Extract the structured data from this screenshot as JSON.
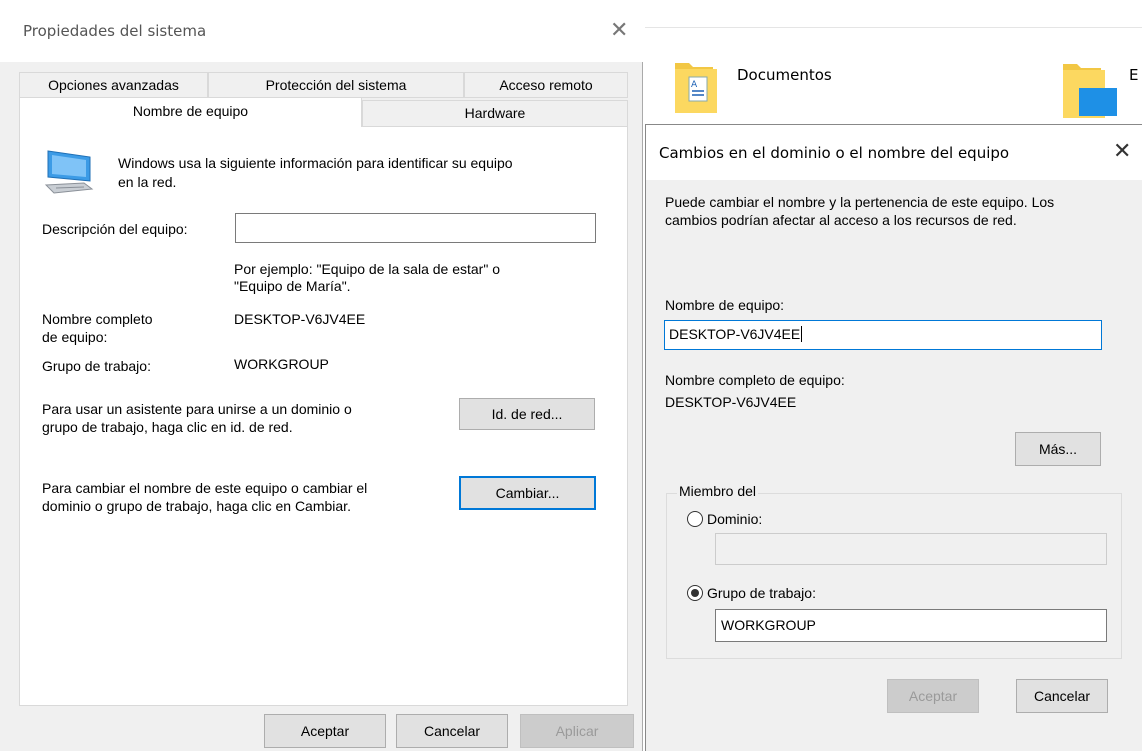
{
  "explorer": {
    "items": [
      {
        "label": "Documentos"
      },
      {
        "label": "E"
      }
    ]
  },
  "system_properties": {
    "title": "Propiedades del sistema",
    "tabs_row1": [
      "Opciones avanzadas",
      "Protección del sistema",
      "Acceso remoto"
    ],
    "tabs_row2": [
      "Nombre de equipo",
      "Hardware"
    ],
    "active_tab": "Nombre de equipo",
    "info_line1": "Windows usa la siguiente información para identificar su equipo",
    "info_line2": "en la red.",
    "description_label": "Descripción del equipo:",
    "description_value": "",
    "example_line1": "Por ejemplo: \"Equipo de la sala de estar\" o",
    "example_line2": "\"Equipo de María\".",
    "fullname_label_line1": "Nombre completo",
    "fullname_label_line2": "de equipo:",
    "fullname_value": "DESKTOP-V6JV4EE",
    "workgroup_label": "Grupo de trabajo:",
    "workgroup_value": "WORKGROUP",
    "network_id_text_line1": "Para usar un asistente para unirse a un dominio o",
    "network_id_text_line2": "grupo de trabajo, haga clic en id. de red.",
    "network_id_button": "Id. de red...",
    "change_text_line1": "Para cambiar el nombre de este equipo o cambiar el",
    "change_text_line2": "dominio o grupo de trabajo, haga clic en Cambiar.",
    "change_button": "Cambiar...",
    "ok_button": "Aceptar",
    "cancel_button": "Cancelar",
    "apply_button": "Aplicar"
  },
  "name_changes": {
    "title": "Cambios en el dominio o el nombre del equipo",
    "intro_line1": "Puede cambiar el nombre y la pertenencia de este equipo. Los",
    "intro_line2": "cambios podrían afectar al acceso a los recursos de red.",
    "computer_name_label": "Nombre de equipo:",
    "computer_name_value": "DESKTOP-V6JV4EE",
    "full_name_label": "Nombre completo de equipo:",
    "full_name_value": "DESKTOP-V6JV4EE",
    "more_button": "Más...",
    "member_of_label": "Miembro del",
    "domain_radio_label": "Dominio:",
    "domain_value": "",
    "workgroup_radio_label": "Grupo de trabajo:",
    "workgroup_value": "WORKGROUP",
    "selected_membership": "workgroup",
    "ok_button": "Aceptar",
    "cancel_button": "Cancelar"
  },
  "colors": {
    "focus_blue": "#0078d7",
    "dialog_bg": "#f0f0f0"
  }
}
